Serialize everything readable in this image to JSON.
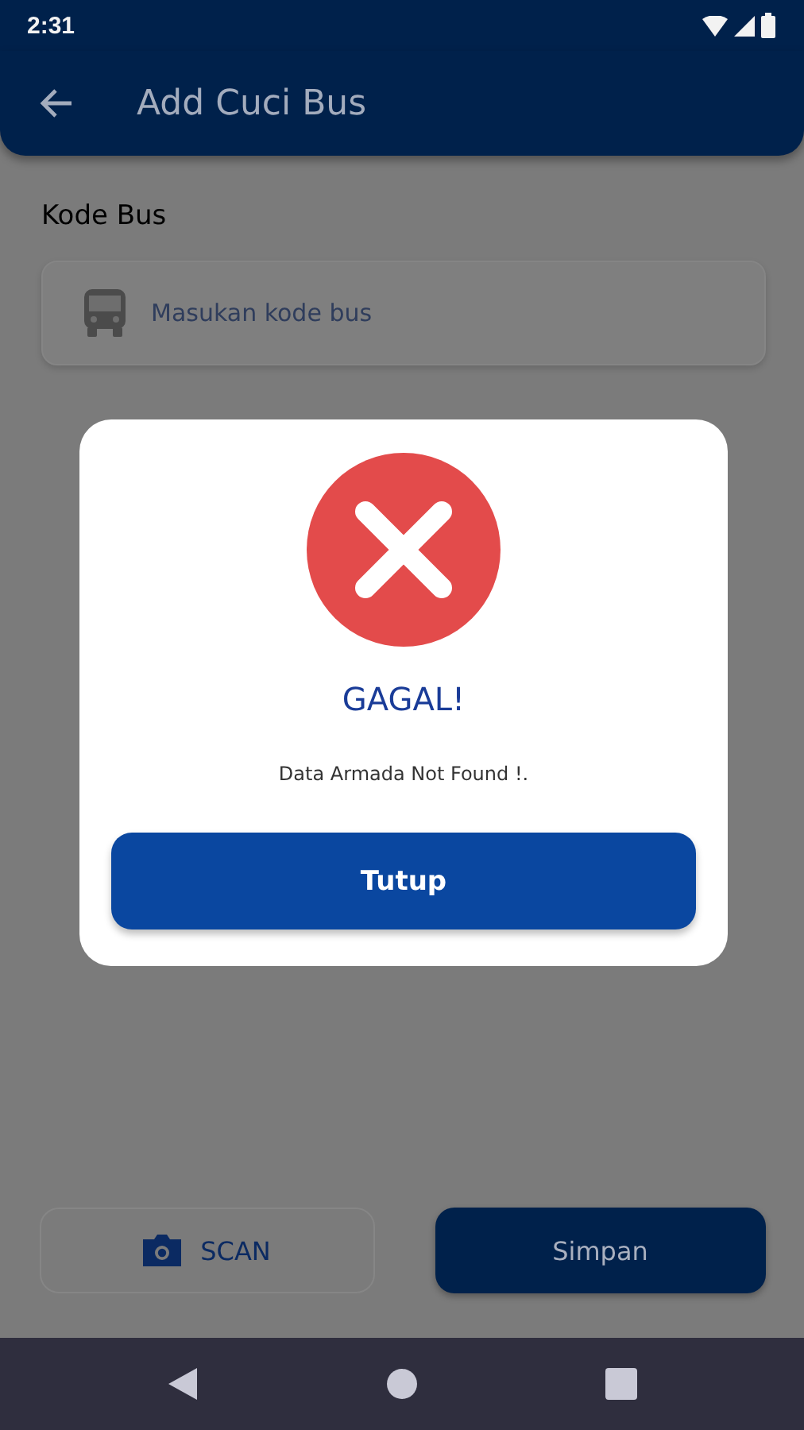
{
  "status_bar": {
    "time": "2:31"
  },
  "app_bar": {
    "title": "Add Cuci Bus"
  },
  "form": {
    "label": "Kode Bus",
    "placeholder": "Masukan kode bus"
  },
  "dialog": {
    "kind": "error",
    "title": "GAGAL!",
    "message": "Data Armada Not Found !.",
    "button": "Tutup"
  },
  "actions": [
    {
      "label": "SCAN",
      "kind": "outlined"
    },
    {
      "label": "Simpan",
      "kind": "filled"
    }
  ]
}
